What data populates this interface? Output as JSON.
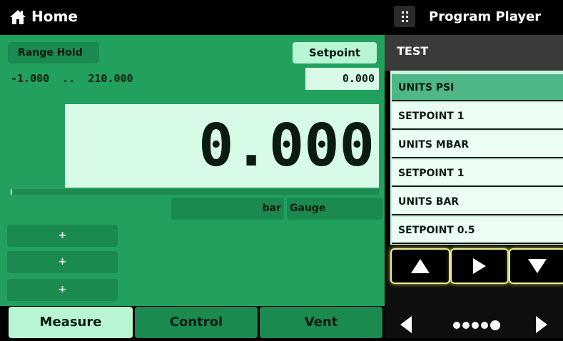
{
  "header": {
    "title": "Home",
    "icon": "home-icon"
  },
  "program_player": {
    "title": "Program Player",
    "icon": "grid-dots-icon",
    "program_name": "TEST",
    "steps": [
      {
        "label": "UNITS PSI",
        "selected": true
      },
      {
        "label": "SETPOINT 1",
        "selected": false
      },
      {
        "label": "UNITS MBAR",
        "selected": false
      },
      {
        "label": "SETPOINT 1",
        "selected": false
      },
      {
        "label": "UNITS BAR",
        "selected": false
      },
      {
        "label": "SETPOINT 0.5",
        "selected": false
      }
    ],
    "nav_icons": [
      "up-arrow-icon",
      "play-icon",
      "down-arrow-icon"
    ],
    "page_indicator": {
      "pages": 5,
      "current": 5
    },
    "page_nav_icons": [
      "left-arrow-icon",
      "right-arrow-icon"
    ]
  },
  "main": {
    "range_hold_label": "Range Hold",
    "setpoint_label": "Setpoint",
    "range_text": "-1.000  ..  210.000",
    "setpoint_value": "0.000",
    "reading": "0.000",
    "unit": "bar",
    "mode": "Gauge",
    "plus_buttons": [
      "+",
      "+",
      "+"
    ]
  },
  "tabs": [
    {
      "label": "Measure",
      "active": true
    },
    {
      "label": "Control",
      "active": false
    },
    {
      "label": "Vent",
      "active": false
    }
  ],
  "colors": {
    "panel_green": "#22a15e",
    "button_green": "#1a8a4f",
    "light_green": "#b7f5d3",
    "display_bg": "#d7fbe7",
    "selected_step": "#4db885",
    "nav_border": "#f1ef8a"
  }
}
